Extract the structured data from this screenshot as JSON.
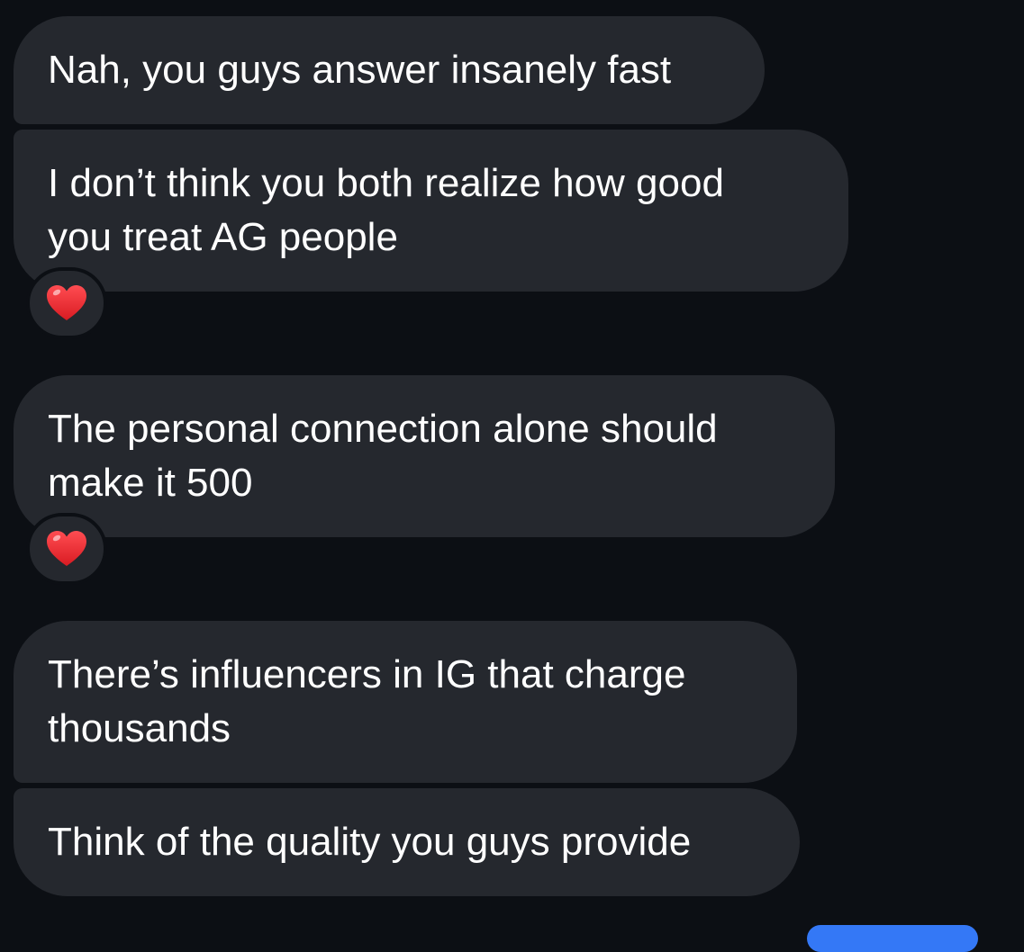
{
  "messages": [
    {
      "id": "msg1",
      "lines": [
        "Nah, you guys answer insanely fast"
      ]
    },
    {
      "id": "msg2",
      "lines": [
        "I don’t think you both realize how good",
        "you treat AG people"
      ],
      "reaction": "red-heart"
    },
    {
      "id": "msg3",
      "lines": [
        "The personal connection alone should",
        "make it 500"
      ],
      "reaction": "red-heart"
    },
    {
      "id": "msg4",
      "lines": [
        "There’s influencers in IG that charge",
        "thousands"
      ]
    },
    {
      "id": "msg5",
      "lines": [
        "Think of the quality you guys provide"
      ]
    }
  ],
  "colors": {
    "background": "#0c0f14",
    "received_bubble": "#25282e",
    "text": "#ffffff",
    "reaction_heart": "#e8282e",
    "sent_bubble": "#3478f6"
  }
}
